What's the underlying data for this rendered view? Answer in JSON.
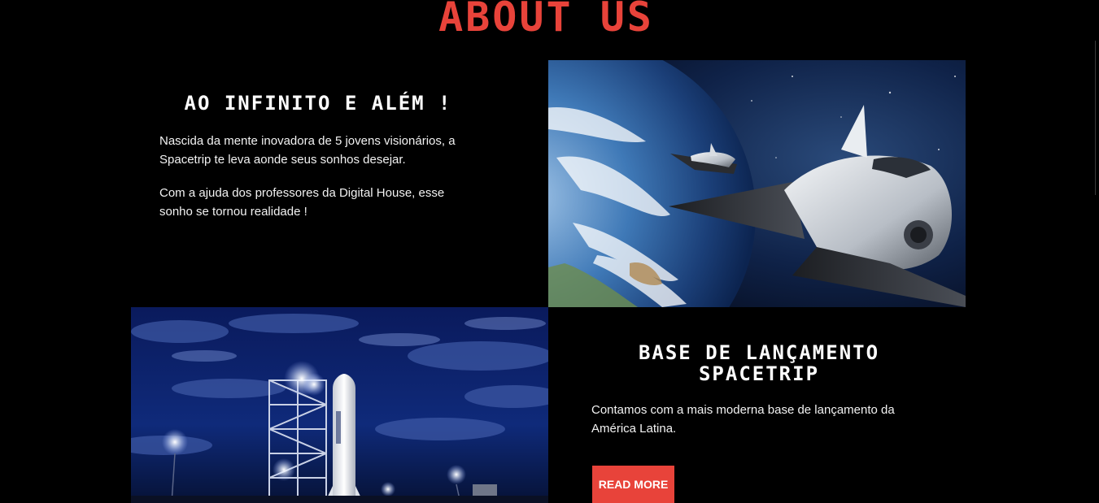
{
  "page": {
    "heading": "ABOUT US",
    "accent_color": "#e8433a",
    "background_color": "#000000"
  },
  "section_infinity": {
    "title": "AO INFINITO E ALÉM !",
    "paragraph_1": "Nascida da mente inovadora de 5 jovens visionários, a Spacetrip te leva aonde seus sonhos desejar.",
    "paragraph_2": "Com a ajuda dos professores da Digital House, esse sonho se tornou realidade !",
    "image_icon": "space-shuttle-earth-photo"
  },
  "section_base": {
    "title": "BASE DE LANÇAMENTO SPACETRIP",
    "paragraph_1": "Contamos com a mais moderna base de lançamento da América Latina.",
    "button_label": "READ MORE",
    "image_icon": "rocket-launch-pad-photo"
  }
}
